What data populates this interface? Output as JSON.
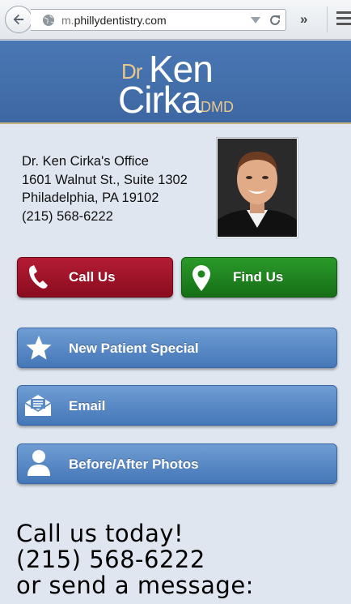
{
  "browser": {
    "url_prefix": "m.",
    "url_host": "phillydentistry.com",
    "overflow_label": "»"
  },
  "header": {
    "logo_dr": "Dr",
    "logo_ken": "Ken",
    "logo_cirka": "Cirka",
    "logo_dmd": "DMD"
  },
  "office": {
    "name": "Dr. Ken Cirka's Office",
    "street": "1601 Walnut St., Suite 1302",
    "city": "Philadelphia, PA 19102",
    "phone": "(215) 568-6222"
  },
  "actions": {
    "call": "Call Us",
    "find": "Find Us",
    "special": "New Patient Special",
    "email": "Email",
    "photos": "Before/After Photos"
  },
  "cta": {
    "line1": "Call us today!",
    "line2": "(215) 568-6222",
    "line3": "or send a message:"
  },
  "colors": {
    "header_blue": "#4a78b4",
    "call_red": "#a3152b",
    "find_green": "#1f861f",
    "button_blue": "#5a8ac6",
    "gold": "#e7c98e"
  }
}
